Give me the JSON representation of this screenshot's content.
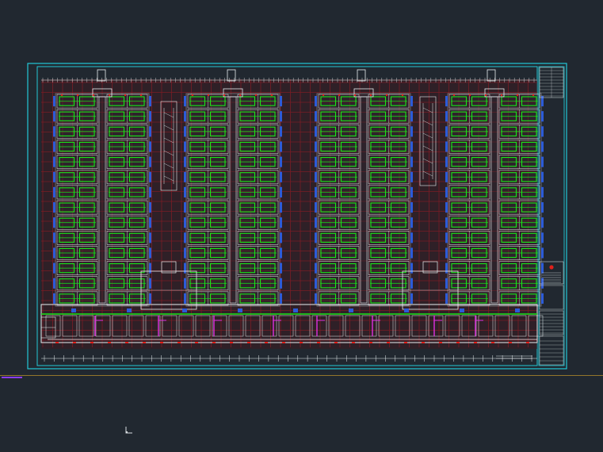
{
  "colors": {
    "background": "#212830",
    "sheet_border": "#22c7d6",
    "grid": "#7a1d26",
    "plan_fill": "#3c1a20",
    "walls": "#e8eef0",
    "fixtures": "#19e619",
    "ducts": "#2c5bd8",
    "pipes": "#e030e0",
    "accent_red": "#e0201a",
    "limit_line": "#b08a2a",
    "layer_line": "#8a3cf0"
  },
  "icons": {
    "ucs": "ucs-icon",
    "compass": "north-marker-icon"
  },
  "plan": {
    "unit_blocks": 4,
    "unit_rows_per_block": 14,
    "unit_columns_per_block": 4
  }
}
